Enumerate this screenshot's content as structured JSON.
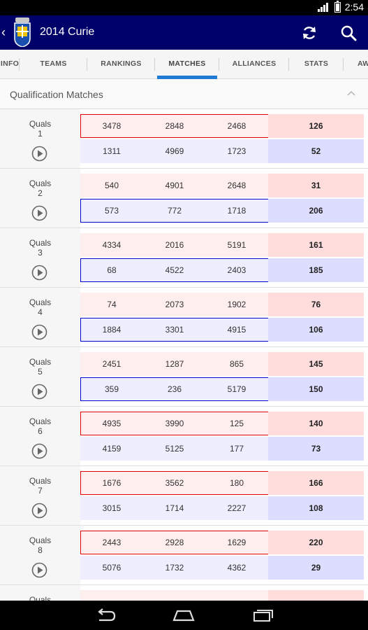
{
  "status": {
    "time": "2:54"
  },
  "header": {
    "title": "2014 Curie"
  },
  "tabs": [
    {
      "label": "INFO"
    },
    {
      "label": "TEAMS"
    },
    {
      "label": "RANKINGS"
    },
    {
      "label": "MATCHES"
    },
    {
      "label": "ALLIANCES"
    },
    {
      "label": "STATS"
    },
    {
      "label": "AW"
    }
  ],
  "active_tab": "MATCHES",
  "section": {
    "title": "Qualification Matches"
  },
  "colors": {
    "action_bar": "#000069",
    "tab_indicator": "#1f7ad6",
    "red_alliance": "#ffeeee",
    "blue_alliance": "#eeeeff",
    "red_winner_border": "#e00000",
    "blue_winner_border": "#0000cc"
  },
  "matches": [
    {
      "label": "Quals",
      "number": "1",
      "winner": "red",
      "red": {
        "teams": [
          "3478",
          "2848",
          "2468"
        ],
        "score": "126"
      },
      "blue": {
        "teams": [
          "1311",
          "4969",
          "1723"
        ],
        "score": "52"
      }
    },
    {
      "label": "Quals",
      "number": "2",
      "winner": "blue",
      "red": {
        "teams": [
          "540",
          "4901",
          "2648"
        ],
        "score": "31"
      },
      "blue": {
        "teams": [
          "573",
          "772",
          "1718"
        ],
        "score": "206"
      }
    },
    {
      "label": "Quals",
      "number": "3",
      "winner": "blue",
      "red": {
        "teams": [
          "4334",
          "2016",
          "5191"
        ],
        "score": "161"
      },
      "blue": {
        "teams": [
          "68",
          "4522",
          "2403"
        ],
        "score": "185"
      }
    },
    {
      "label": "Quals",
      "number": "4",
      "winner": "blue",
      "red": {
        "teams": [
          "74",
          "2073",
          "1902"
        ],
        "score": "76"
      },
      "blue": {
        "teams": [
          "1884",
          "3301",
          "4915"
        ],
        "score": "106"
      }
    },
    {
      "label": "Quals",
      "number": "5",
      "winner": "blue",
      "red": {
        "teams": [
          "2451",
          "1287",
          "865"
        ],
        "score": "145"
      },
      "blue": {
        "teams": [
          "359",
          "236",
          "5179"
        ],
        "score": "150"
      }
    },
    {
      "label": "Quals",
      "number": "6",
      "winner": "red",
      "red": {
        "teams": [
          "4935",
          "3990",
          "125"
        ],
        "score": "140"
      },
      "blue": {
        "teams": [
          "4159",
          "5125",
          "177"
        ],
        "score": "73"
      }
    },
    {
      "label": "Quals",
      "number": "7",
      "winner": "red",
      "red": {
        "teams": [
          "1676",
          "3562",
          "180"
        ],
        "score": "166"
      },
      "blue": {
        "teams": [
          "3015",
          "1714",
          "2227"
        ],
        "score": "108"
      }
    },
    {
      "label": "Quals",
      "number": "8",
      "winner": "red",
      "red": {
        "teams": [
          "2443",
          "2928",
          "1629"
        ],
        "score": "220"
      },
      "blue": {
        "teams": [
          "5076",
          "1732",
          "4362"
        ],
        "score": "29"
      }
    },
    {
      "label": "Quals",
      "number": "",
      "winner": "",
      "red": {
        "teams": [
          "",
          "",
          ""
        ],
        "score": ""
      },
      "blue": {
        "teams": [
          "",
          "",
          ""
        ],
        "score": ""
      }
    }
  ],
  "icons": {
    "back": "chevron-left-icon",
    "logo": "app-logo",
    "refresh": "refresh-icon",
    "search": "search-icon",
    "collapse": "chevron-up-icon",
    "play": "play-icon",
    "nav_back": "nav-back-icon",
    "nav_home": "nav-home-icon",
    "nav_recents": "nav-recents-icon"
  }
}
